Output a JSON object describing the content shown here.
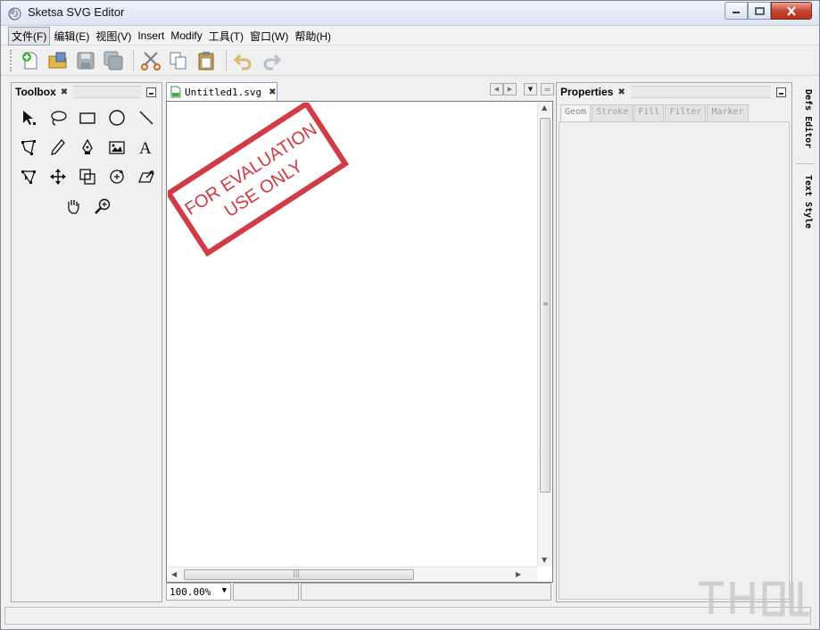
{
  "window": {
    "title": "Sketsa SVG Editor"
  },
  "menu": [
    "文件(F)",
    "编辑(E)",
    "视图(V)",
    "Insert",
    "Modify",
    "工具(T)",
    "窗口(W)",
    "帮助(H)"
  ],
  "toolbar": {
    "buttons": [
      "new-file",
      "open-file",
      "save",
      "save-all",
      "cut",
      "copy",
      "paste",
      "undo",
      "redo"
    ]
  },
  "toolbox": {
    "title": "Toolbox",
    "tools": [
      "select",
      "lasso",
      "rectangle",
      "ellipse",
      "line",
      "polygon",
      "pencil",
      "pen",
      "image",
      "text",
      "node-edit",
      "move",
      "scale",
      "rotate",
      "skew",
      "hand",
      "zoom"
    ]
  },
  "editor": {
    "tab_label": "Untitled1.svg",
    "stamp_line1": "FOR EVALUATION",
    "stamp_line2": "USE ONLY",
    "zoom": "100.00%"
  },
  "properties": {
    "title": "Properties",
    "tabs": [
      "Geom",
      "Stroke",
      "Fill",
      "Filter",
      "Marker"
    ],
    "active_tab": "Geom"
  },
  "side_tabs": [
    "Defs Editor",
    "Text Style"
  ],
  "colors": {
    "stamp": "#d23a44",
    "accent": "#3c7ec5"
  }
}
